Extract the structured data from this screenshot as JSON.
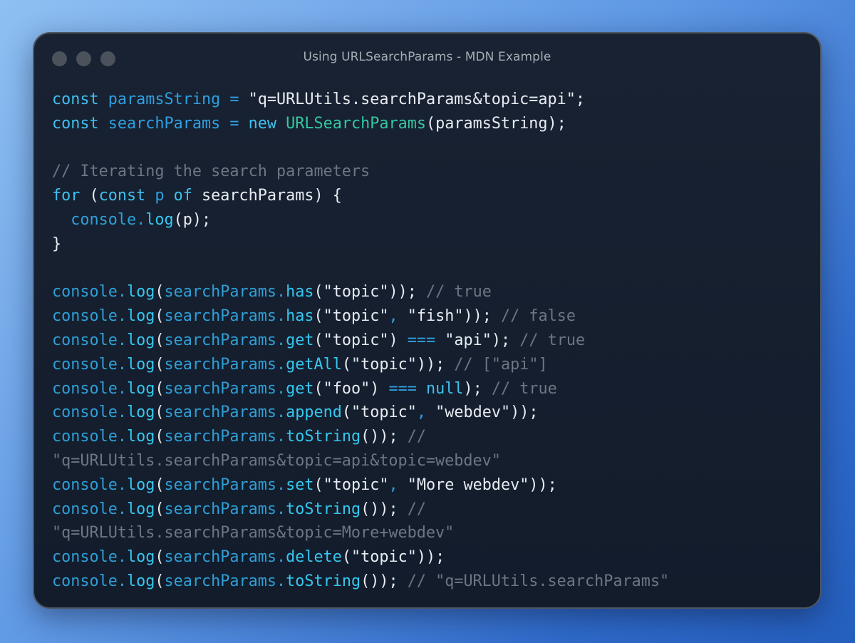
{
  "window": {
    "title": "Using URLSearchParams - MDN Example",
    "controls": [
      "close",
      "minimize",
      "zoom"
    ]
  },
  "colors": {
    "background": "#5f98e4",
    "window_background": "#151f2e",
    "keyword": "#3fc0ee",
    "variable": "#2f9fe0",
    "function": "#34c7a0",
    "method": "#35c8f0",
    "plain": "#e8ecf2",
    "comment": "#6c7684"
  },
  "code": {
    "lines": [
      [
        [
          "kw",
          "const"
        ],
        [
          "pl",
          " "
        ],
        [
          "vr",
          "paramsString"
        ],
        [
          "pl",
          " "
        ],
        [
          "op",
          "="
        ],
        [
          "pl",
          " "
        ],
        [
          "str",
          "\"q=URLUtils.searchParams&topic=api\""
        ],
        [
          "pl",
          ";"
        ]
      ],
      [
        [
          "kw",
          "const"
        ],
        [
          "pl",
          " "
        ],
        [
          "vr",
          "searchParams"
        ],
        [
          "pl",
          " "
        ],
        [
          "op",
          "="
        ],
        [
          "pl",
          " "
        ],
        [
          "kw",
          "new"
        ],
        [
          "pl",
          " "
        ],
        [
          "fn",
          "URLSearchParams"
        ],
        [
          "pl",
          "(paramsString);"
        ]
      ],
      [],
      [
        [
          "cm",
          "// Iterating the search parameters"
        ]
      ],
      [
        [
          "kw",
          "for"
        ],
        [
          "pl",
          " ("
        ],
        [
          "kw",
          "const"
        ],
        [
          "pl",
          " "
        ],
        [
          "vr",
          "p"
        ],
        [
          "pl",
          " "
        ],
        [
          "kw",
          "of"
        ],
        [
          "pl",
          " searchParams) {"
        ]
      ],
      [
        [
          "pl",
          "  "
        ],
        [
          "obj",
          "console."
        ],
        [
          "mth",
          "log"
        ],
        [
          "pl",
          "(p);"
        ]
      ],
      [
        [
          "pl",
          "}"
        ]
      ],
      [],
      [
        [
          "obj",
          "console."
        ],
        [
          "mth",
          "log"
        ],
        [
          "pl",
          "("
        ],
        [
          "obj",
          "searchParams."
        ],
        [
          "mth",
          "has"
        ],
        [
          "pl",
          "("
        ],
        [
          "str",
          "\"topic\""
        ],
        [
          "pl",
          "));"
        ],
        [
          "cm",
          " // true"
        ]
      ],
      [
        [
          "obj",
          "console."
        ],
        [
          "mth",
          "log"
        ],
        [
          "pl",
          "("
        ],
        [
          "obj",
          "searchParams."
        ],
        [
          "mth",
          "has"
        ],
        [
          "pl",
          "("
        ],
        [
          "str",
          "\"topic\""
        ],
        [
          "op",
          ","
        ],
        [
          "pl",
          " "
        ],
        [
          "str",
          "\"fish\""
        ],
        [
          "pl",
          "));"
        ],
        [
          "cm",
          " // false"
        ]
      ],
      [
        [
          "obj",
          "console."
        ],
        [
          "mth",
          "log"
        ],
        [
          "pl",
          "("
        ],
        [
          "obj",
          "searchParams."
        ],
        [
          "mth",
          "get"
        ],
        [
          "pl",
          "("
        ],
        [
          "str",
          "\"topic\""
        ],
        [
          "pl",
          ") "
        ],
        [
          "op",
          "==="
        ],
        [
          "pl",
          " "
        ],
        [
          "str",
          "\"api\""
        ],
        [
          "pl",
          ");"
        ],
        [
          "cm",
          " // true"
        ]
      ],
      [
        [
          "obj",
          "console."
        ],
        [
          "mth",
          "log"
        ],
        [
          "pl",
          "("
        ],
        [
          "obj",
          "searchParams."
        ],
        [
          "mth",
          "getAll"
        ],
        [
          "pl",
          "("
        ],
        [
          "str",
          "\"topic\""
        ],
        [
          "pl",
          "));"
        ],
        [
          "cm",
          " // [\"api\"]"
        ]
      ],
      [
        [
          "obj",
          "console."
        ],
        [
          "mth",
          "log"
        ],
        [
          "pl",
          "("
        ],
        [
          "obj",
          "searchParams."
        ],
        [
          "mth",
          "get"
        ],
        [
          "pl",
          "("
        ],
        [
          "str",
          "\"foo\""
        ],
        [
          "pl",
          ") "
        ],
        [
          "op",
          "==="
        ],
        [
          "pl",
          " "
        ],
        [
          "kw",
          "null"
        ],
        [
          "pl",
          ");"
        ],
        [
          "cm",
          " // true"
        ]
      ],
      [
        [
          "obj",
          "console."
        ],
        [
          "mth",
          "log"
        ],
        [
          "pl",
          "("
        ],
        [
          "obj",
          "searchParams."
        ],
        [
          "mth",
          "append"
        ],
        [
          "pl",
          "("
        ],
        [
          "str",
          "\"topic\""
        ],
        [
          "op",
          ","
        ],
        [
          "pl",
          " "
        ],
        [
          "str",
          "\"webdev\""
        ],
        [
          "pl",
          "));"
        ]
      ],
      [
        [
          "obj",
          "console."
        ],
        [
          "mth",
          "log"
        ],
        [
          "pl",
          "("
        ],
        [
          "obj",
          "searchParams."
        ],
        [
          "mth",
          "toString"
        ],
        [
          "pl",
          "());"
        ],
        [
          "cm",
          " //"
        ]
      ],
      [
        [
          "cm",
          "\"q=URLUtils.searchParams&topic=api&topic=webdev\""
        ]
      ],
      [
        [
          "obj",
          "console."
        ],
        [
          "mth",
          "log"
        ],
        [
          "pl",
          "("
        ],
        [
          "obj",
          "searchParams."
        ],
        [
          "mth",
          "set"
        ],
        [
          "pl",
          "("
        ],
        [
          "str",
          "\"topic\""
        ],
        [
          "op",
          ","
        ],
        [
          "pl",
          " "
        ],
        [
          "str",
          "\"More webdev\""
        ],
        [
          "pl",
          "));"
        ]
      ],
      [
        [
          "obj",
          "console."
        ],
        [
          "mth",
          "log"
        ],
        [
          "pl",
          "("
        ],
        [
          "obj",
          "searchParams."
        ],
        [
          "mth",
          "toString"
        ],
        [
          "pl",
          "());"
        ],
        [
          "cm",
          " //"
        ]
      ],
      [
        [
          "cm",
          "\"q=URLUtils.searchParams&topic=More+webdev\""
        ]
      ],
      [
        [
          "obj",
          "console."
        ],
        [
          "mth",
          "log"
        ],
        [
          "pl",
          "("
        ],
        [
          "obj",
          "searchParams."
        ],
        [
          "mth",
          "delete"
        ],
        [
          "pl",
          "("
        ],
        [
          "str",
          "\"topic\""
        ],
        [
          "pl",
          "));"
        ]
      ],
      [
        [
          "obj",
          "console."
        ],
        [
          "mth",
          "log"
        ],
        [
          "pl",
          "("
        ],
        [
          "obj",
          "searchParams."
        ],
        [
          "mth",
          "toString"
        ],
        [
          "pl",
          "());"
        ],
        [
          "cm",
          " // \"q=URLUtils.searchParams\""
        ]
      ]
    ]
  }
}
